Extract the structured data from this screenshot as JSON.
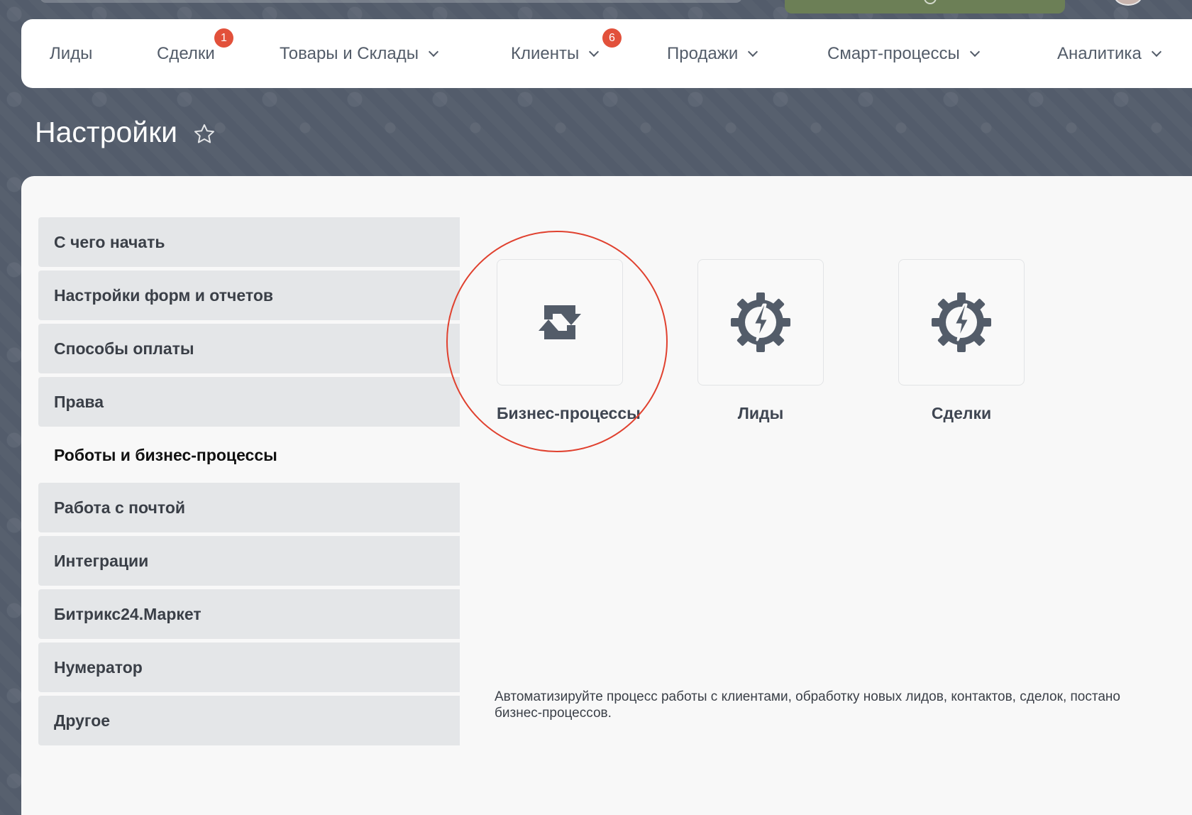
{
  "nav": {
    "items": [
      {
        "label": "Лиды"
      },
      {
        "label": "Сделки",
        "badge": "1"
      },
      {
        "label": "Товары и Склады"
      },
      {
        "label": "Клиенты",
        "badge": "6"
      },
      {
        "label": "Продажи"
      },
      {
        "label": "Смарт-процессы"
      },
      {
        "label": "Аналитика"
      }
    ]
  },
  "page": {
    "title": "Настройки"
  },
  "sidebar": {
    "items": [
      {
        "label": "С чего начать"
      },
      {
        "label": "Настройки форм и отчетов"
      },
      {
        "label": "Способы оплаты"
      },
      {
        "label": "Права"
      },
      {
        "label": "Роботы и бизнес-процессы",
        "active": true
      },
      {
        "label": "Работа с почтой"
      },
      {
        "label": "Интеграции"
      },
      {
        "label": "Битрикс24.Маркет"
      },
      {
        "label": "Нумератор"
      },
      {
        "label": "Другое"
      }
    ]
  },
  "tiles": [
    {
      "label": "Бизнес-процессы",
      "icon": "refresh-arrows-icon"
    },
    {
      "label": "Лиды",
      "icon": "gear-lightning-icon"
    },
    {
      "label": "Сделки",
      "icon": "gear-lightning-icon"
    }
  ],
  "description": {
    "line1": "Автоматизируйте процесс работы с клиентами, обработку новых лидов, контактов, сделок, постано",
    "line2": "бизнес-процессов."
  },
  "colors": {
    "accent_red": "#e2513b",
    "highlight_circle": "#e0412f",
    "background": "#535c6b",
    "icon_dark": "#535c69"
  }
}
